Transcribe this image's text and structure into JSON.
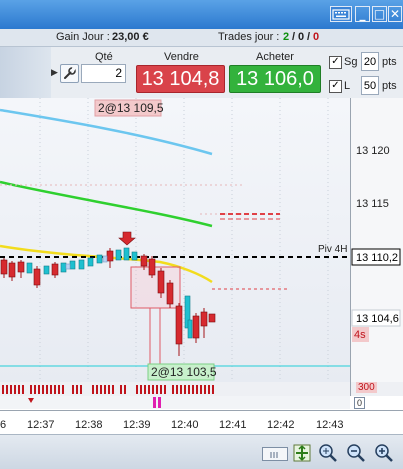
{
  "window": {
    "keyboard_icon": "keyboard-icon",
    "minimize_label": "_",
    "maximize_label": "□",
    "close_label": "✕"
  },
  "info": {
    "gain_label": "Gain Jour :",
    "gain_value": "23,00 €",
    "trades_label": "Trades jour :",
    "trades_won": "2",
    "trades_sep1": "/",
    "trades_mid": "0",
    "trades_sep2": "/",
    "trades_lost": "0",
    "colors": {
      "won": "#0d8f0d",
      "lost": "#c0141c"
    }
  },
  "order": {
    "qty_label": "Qté",
    "qty_value": "2",
    "sell_label": "Vendre",
    "sell_price": "13 104,8",
    "buy_label": "Acheter",
    "buy_price": "13 106,0",
    "sg_label": "Sg",
    "sg_checked": "✓",
    "sg_value": "20",
    "sg_unit": "pts",
    "l_label": "L",
    "l_checked": "✓",
    "l_value": "50",
    "l_unit": "pts",
    "colors": {
      "sell": "#d9434a",
      "buy": "#33b23c"
    }
  },
  "chart": {
    "top_order_label": "2@13 109,5",
    "bottom_order_label": "2@13 103,5",
    "piv_label": "Piv 4H",
    "price_ticks": [
      "13 120",
      "13 115",
      "13 110,2",
      "13 104,6"
    ],
    "countdown": "4s",
    "volume_scale": "300",
    "signal_scale": "0",
    "time_ticks": [
      "6",
      "12:37",
      "12:38",
      "12:39",
      "12:40",
      "12:41",
      "12:42",
      "12:43"
    ]
  },
  "toolbar": {
    "icons": [
      "scrollbar-thumb",
      "pan-icon",
      "zoom-fit-icon",
      "zoom-out-icon",
      "zoom-in-icon"
    ]
  }
}
